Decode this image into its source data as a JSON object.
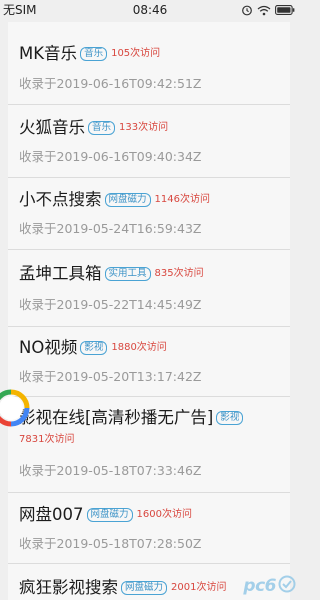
{
  "status_bar": {
    "carrier": "无SIM",
    "time": "08:46",
    "icons": [
      "alarm-icon",
      "wifi-icon",
      "battery-icon"
    ]
  },
  "list": {
    "items": [
      {
        "title": "MK音乐",
        "tag": "音乐",
        "visits": "105次访问",
        "date": "收录于2019-06-16T09:42:51Z"
      },
      {
        "title": "火狐音乐",
        "tag": "音乐",
        "visits": "133次访问",
        "date": "收录于2019-06-16T09:40:34Z"
      },
      {
        "title": "小不点搜索",
        "tag": "网盘磁力",
        "visits": "1146次访问",
        "date": "收录于2019-05-24T16:59:43Z"
      },
      {
        "title": "孟坤工具箱",
        "tag": "实用工具",
        "visits": "835次访问",
        "date": "收录于2019-05-22T14:45:49Z"
      },
      {
        "title": "NO视频",
        "tag": "影视",
        "visits": "1880次访问",
        "date": "收录于2019-05-20T13:17:42Z"
      },
      {
        "title": "影视在线[高清秒播无广告]",
        "tag": "影视",
        "visits": "7831次访问",
        "date": "收录于2019-05-18T07:33:46Z"
      },
      {
        "title": "网盘007",
        "tag": "网盘磁力",
        "visits": "1600次访问",
        "date": "收录于2019-05-18T07:28:50Z"
      },
      {
        "title": "疯狂影视搜索",
        "tag": "网盘磁力",
        "visits": "2001次访问",
        "date": ""
      }
    ]
  },
  "watermark": {
    "text": "pc6"
  },
  "colors": {
    "tag_border": "#4aa3d4",
    "visits": "#d8473f",
    "timestamp": "#9a9a9a",
    "divider": "#dcdcdc"
  }
}
